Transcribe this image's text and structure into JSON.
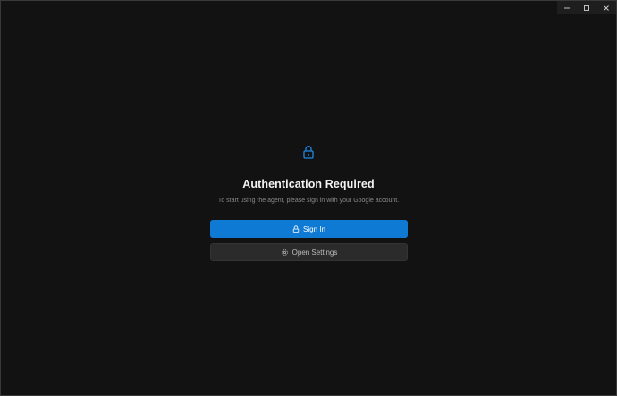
{
  "window": {
    "controls": {
      "minimize_icon": "minimize-icon",
      "maximize_icon": "maximize-icon",
      "close_icon": "close-icon"
    }
  },
  "auth": {
    "icon": "lock-icon",
    "title": "Authentication Required",
    "subtitle": "To start using the agent, please sign in with your Google account.",
    "sign_in_label": "Sign In",
    "sign_in_icon": "lock-icon",
    "settings_label": "Open Settings",
    "settings_icon": "gear-icon"
  },
  "colors": {
    "background": "#121212",
    "accent": "#0f7ad4",
    "secondary_button": "#2b2b2b",
    "title_text": "#f2f2f2",
    "subtitle_text": "#8a8a8a"
  }
}
